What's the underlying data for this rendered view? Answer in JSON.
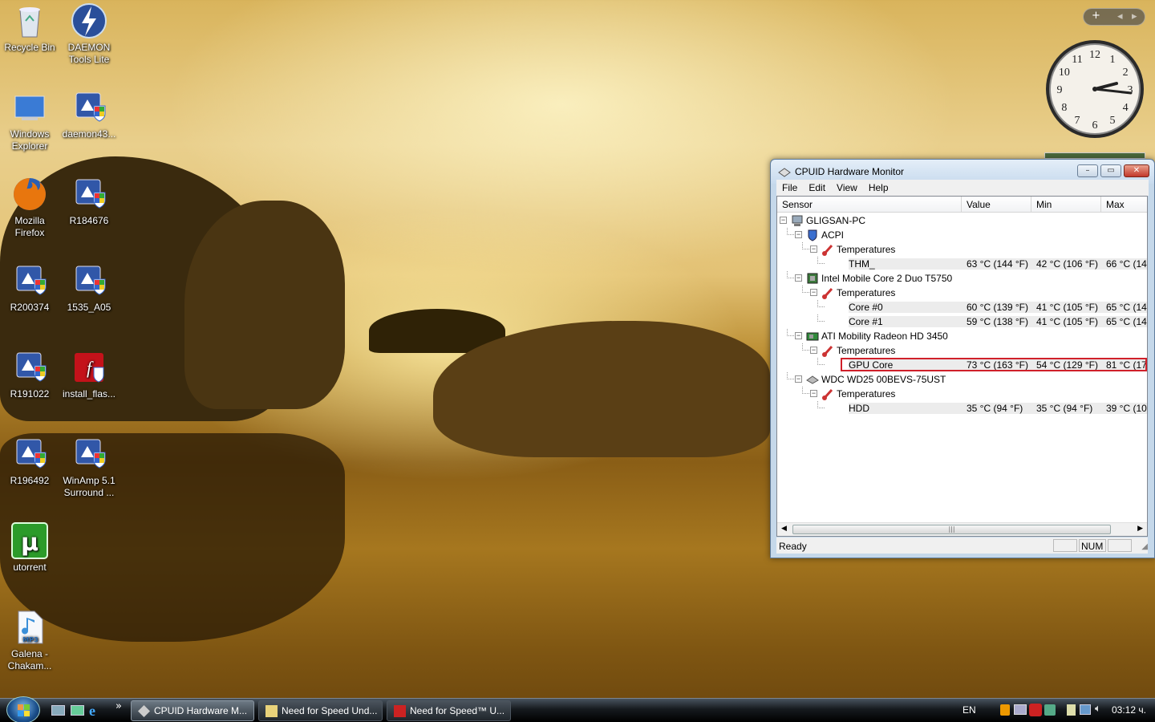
{
  "desktop": {
    "icons": [
      {
        "label": "Recycle Bin",
        "icon": "recycle-bin-icon"
      },
      {
        "label": "DAEMON Tools Lite",
        "icon": "daemon-tools-icon"
      },
      {
        "label": "Windows Explorer",
        "icon": "windows-explorer-icon"
      },
      {
        "label": "daemon43...",
        "icon": "installer-icon"
      },
      {
        "label": "Mozilla Firefox",
        "icon": "firefox-icon"
      },
      {
        "label": "R184676",
        "icon": "installer-icon"
      },
      {
        "label": "R200374",
        "icon": "installer-icon"
      },
      {
        "label": "1535_A05",
        "icon": "installer-icon"
      },
      {
        "label": "R191022",
        "icon": "installer-icon"
      },
      {
        "label": "install_flas...",
        "icon": "flash-installer-icon"
      },
      {
        "label": "R196492",
        "icon": "installer-icon"
      },
      {
        "label": "WinAmp 5.1 Surround ...",
        "icon": "installer-icon"
      },
      {
        "label": "utorrent",
        "icon": "utorrent-icon"
      },
      {
        "label": "Galena - Chakam...",
        "icon": "mp3-file-icon"
      }
    ],
    "mp3_badge": "MP3",
    "utorrent_glyph": "µ"
  },
  "clock": {
    "numerals": [
      "12",
      "1",
      "2",
      "3",
      "4",
      "5",
      "6",
      "7",
      "8",
      "9",
      "10",
      "11"
    ]
  },
  "window": {
    "title": "CPUID Hardware Monitor",
    "menu": [
      "File",
      "Edit",
      "View",
      "Help"
    ],
    "columns": [
      "Sensor",
      "Value",
      "Min",
      "Max"
    ],
    "rows": [
      {
        "label": "GLIGSAN-PC",
        "level": 0,
        "icon": "computer",
        "toggle": "−",
        "value": "",
        "min": "",
        "max": ""
      },
      {
        "label": "ACPI",
        "level": 1,
        "icon": "acpi",
        "toggle": "−",
        "value": "",
        "min": "",
        "max": ""
      },
      {
        "label": "Temperatures",
        "level": 2,
        "icon": "thermometer",
        "toggle": "−",
        "value": "",
        "min": "",
        "max": ""
      },
      {
        "label": "THM_",
        "level": 3,
        "icon": "",
        "toggle": "",
        "value": "63 °C  (144 °F)",
        "min": "42 °C  (106 °F)",
        "max": "66 °C  (14"
      },
      {
        "label": "Intel Mobile Core 2 Duo T5750",
        "level": 1,
        "icon": "cpu",
        "toggle": "−",
        "value": "",
        "min": "",
        "max": ""
      },
      {
        "label": "Temperatures",
        "level": 2,
        "icon": "thermometer",
        "toggle": "−",
        "value": "",
        "min": "",
        "max": ""
      },
      {
        "label": "Core #0",
        "level": 3,
        "icon": "",
        "toggle": "",
        "value": "60 °C  (139 °F)",
        "min": "41 °C  (105 °F)",
        "max": "65 °C  (14"
      },
      {
        "label": "Core #1",
        "level": 3,
        "icon": "",
        "toggle": "",
        "value": "59 °C  (138 °F)",
        "min": "41 °C  (105 °F)",
        "max": "65 °C  (14"
      },
      {
        "label": "ATI Mobility Radeon HD 3450",
        "level": 1,
        "icon": "gpu",
        "toggle": "−",
        "value": "",
        "min": "",
        "max": ""
      },
      {
        "label": "Temperatures",
        "level": 2,
        "icon": "thermometer",
        "toggle": "−",
        "value": "",
        "min": "",
        "max": ""
      },
      {
        "label": "GPU Core",
        "level": 3,
        "icon": "",
        "toggle": "",
        "value": "73 °C  (163 °F)",
        "min": "54 °C  (129 °F)",
        "max": "81 °C  (17",
        "highlight": true
      },
      {
        "label": "WDC WD25 00BEVS-75UST",
        "level": 1,
        "icon": "hdd",
        "toggle": "−",
        "value": "",
        "min": "",
        "max": ""
      },
      {
        "label": "Temperatures",
        "level": 2,
        "icon": "thermometer",
        "toggle": "−",
        "value": "",
        "min": "",
        "max": ""
      },
      {
        "label": "HDD",
        "level": 3,
        "icon": "",
        "toggle": "",
        "value": "35 °C  (94 °F)",
        "min": "35 °C  (94 °F)",
        "max": "39 °C  (10."
      }
    ],
    "status": {
      "text": "Ready",
      "num": "NUM"
    },
    "highlight_color": "#d0202a"
  },
  "taskbar": {
    "quick_launch_chevron": "»",
    "buttons": [
      {
        "label": "CPUID Hardware M...",
        "active": true
      },
      {
        "label": "Need for Speed Und...",
        "active": false
      },
      {
        "label": "Need for Speed™ U...",
        "active": false
      }
    ],
    "language": "EN",
    "time": "03:12 ч."
  },
  "sidebar": {
    "add_glyph": "+",
    "prev_glyph": "◂",
    "next_glyph": "▸"
  }
}
